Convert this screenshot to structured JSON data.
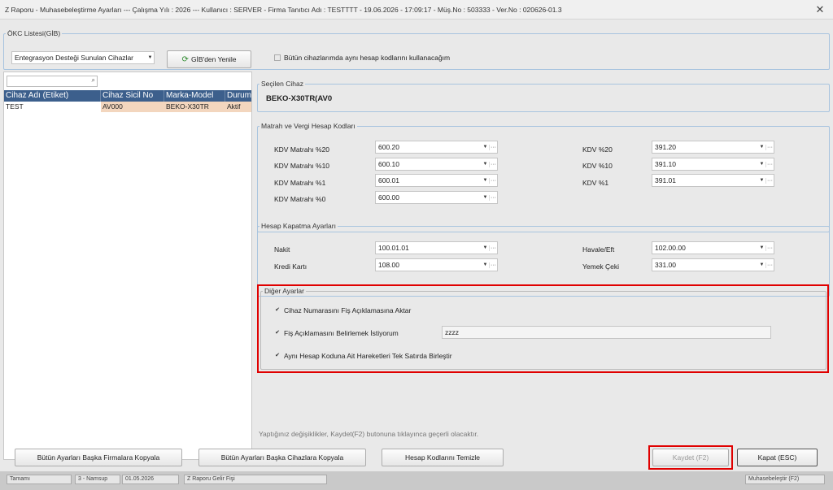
{
  "window": {
    "title": "Z Raporu - Muhasebeleştirme Ayarları  ---  Çalışma Yılı : 2026  ---  Kullanıcı : SERVER - Firma Tanıtıcı Adı : TESTTTT - 19.06.2026 - 17:09:17 - Müş.No : 503333 - Ver.No : 020626-01.3",
    "close": "✕"
  },
  "okc": {
    "legend": "ÖKC Listesi(GİB)",
    "device_filter": "Entegrasyon Desteği Sunulan Cihazlar",
    "refresh_label": "GİB'den Yenile",
    "same_codes_label": "Bütün cihazlarımda aynı hesap kodlarını kullanacağım"
  },
  "device_grid": {
    "search_value": "",
    "columns": [
      "Cihaz Adı (Etiket)",
      "Cihaz Sicil No",
      "Marka-Model",
      "Durum"
    ],
    "rows": [
      [
        "TEST",
        "AV000",
        "BEKO-X30TR",
        "Aktif"
      ]
    ]
  },
  "selected_device": {
    "legend": "Seçilen Cihaz",
    "value": "BEKO-X30TR(AV0"
  },
  "matrah": {
    "legend": "Matrah ve Vergi Hesap Kodları",
    "items": [
      {
        "label": "KDV Matrahı %20",
        "value": "600.20"
      },
      {
        "label": "KDV Matrahı %10",
        "value": "600.10"
      },
      {
        "label": "KDV Matrahı %1",
        "value": "600.01"
      },
      {
        "label": "KDV Matrahı %0",
        "value": "600.00"
      },
      {
        "label": "KDV %20",
        "value": "391.20"
      },
      {
        "label": "KDV %10",
        "value": "391.10"
      },
      {
        "label": "KDV %1",
        "value": "391.01"
      }
    ]
  },
  "kapatma": {
    "legend": "Hesap Kapatma Ayarları",
    "items": [
      {
        "label": "Nakit",
        "value": "100.01.01"
      },
      {
        "label": "Kredi Kartı",
        "value": "108.00"
      },
      {
        "label": "Havale/Eft",
        "value": "102.00.00"
      },
      {
        "label": "Yemek Çeki",
        "value": "331.00"
      }
    ]
  },
  "diger": {
    "legend": "Diğer Ayarlar",
    "opt1": "Cihaz Numarasını Fiş Açıklamasına Aktar",
    "opt2": "Fiş Açıklamasını Belirlemek İstiyorum",
    "opt2_value": "zzzz",
    "opt3": "Aynı Hesap Koduna Ait Hareketleri Tek Satırda Birleştir"
  },
  "info_text": "Yaptığınız değişiklikler, Kaydet(F2) butonuna tıklayınca geçerli olacaktır.",
  "buttons": {
    "copy_firms": "Bütün Ayarları Başka Firmalara Kopyala",
    "copy_devices": "Bütün Ayarları Başka Cihazlara Kopyala",
    "clear_codes": "Hesap Kodlarını Temizle",
    "save": "Kaydet (F2)",
    "close": "Kapat (ESC)"
  },
  "bottom_strip": {
    "items": [
      "Tamamı",
      "3 - Namsup",
      "01.05.2026",
      "Z Raporu Gelir Fişi",
      "Muhasebeleştir (F2)"
    ]
  },
  "colors": {
    "grid_header": "#3c5f8c",
    "highlight_red": "#e00000",
    "row_highlight": "#f3d6be",
    "group_border": "#a8c4df"
  }
}
